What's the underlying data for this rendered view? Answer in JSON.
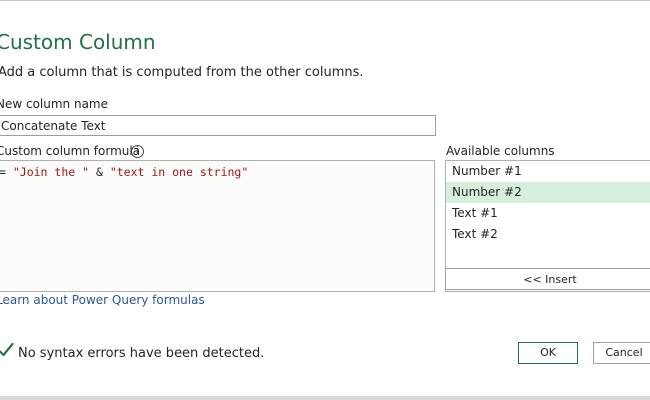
{
  "dialog": {
    "title": "Custom Column",
    "subtitle": "Add a column that is computed from the other columns."
  },
  "column_name": {
    "label": "New column name",
    "value": "Concatenate Text"
  },
  "formula": {
    "label": "Custom column formula",
    "info_icon": "info-icon",
    "prefix": "= ",
    "string1": "\"Join the \"",
    "operator": " & ",
    "string2": "\"text in one string\"",
    "string_color": "#a31515"
  },
  "available_columns": {
    "label": "Available columns",
    "items": [
      {
        "label": "Number #1",
        "selected": false
      },
      {
        "label": "Number #2",
        "selected": true
      },
      {
        "label": "Text #1",
        "selected": false
      },
      {
        "label": "Text #2",
        "selected": false
      }
    ],
    "insert_label": "<< Insert"
  },
  "learn_link": "Learn about Power Query formulas",
  "status": {
    "icon": "check-icon",
    "text": "No syntax errors have been detected."
  },
  "buttons": {
    "ok": "OK",
    "cancel": "Cancel"
  },
  "colors": {
    "accent": "#217346",
    "selection": "#d6efdd",
    "link": "#2b579a"
  }
}
